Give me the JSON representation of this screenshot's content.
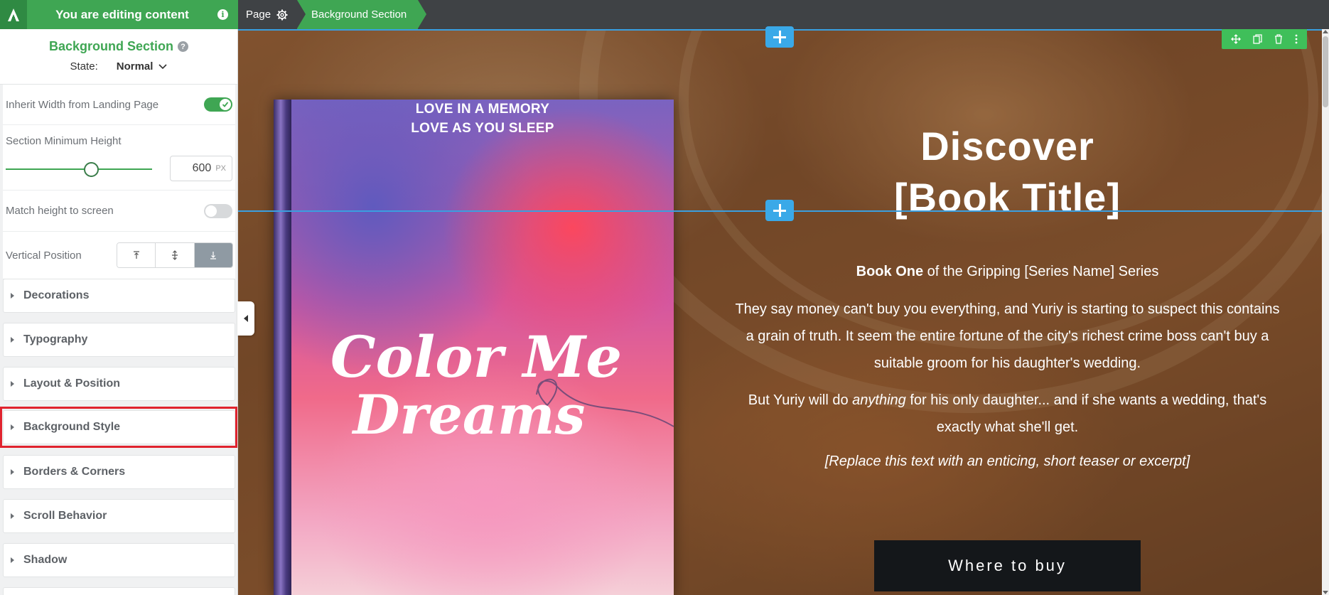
{
  "topbar": {
    "editing_label": "You are editing content",
    "crumbs": {
      "page": "Page",
      "active": "Background Section"
    }
  },
  "sidebar": {
    "title": "Background Section",
    "state_label": "State:",
    "state_value": "Normal",
    "inherit_width_label": "Inherit Width from Landing Page",
    "inherit_width_on": true,
    "min_height_label": "Section Minimum Height",
    "min_height_value": "600",
    "min_height_unit": "PX",
    "match_height_label": "Match height to screen",
    "match_height_on": false,
    "vertical_position_label": "Vertical Position",
    "vertical_position_active": "bottom",
    "accordions": [
      {
        "label": "Decorations"
      },
      {
        "label": "Typography"
      },
      {
        "label": "Layout & Position"
      },
      {
        "label": "Background Style"
      },
      {
        "label": "Borders & Corners"
      },
      {
        "label": "Scroll Behavior"
      },
      {
        "label": "Shadow"
      }
    ]
  },
  "canvas": {
    "book": {
      "tagline_1": "LOVE IN A MEMORY",
      "tagline_2": "LOVE AS YOU SLEEP",
      "title_1": "Color Me",
      "title_2": "Dreams"
    },
    "hero": {
      "heading_1": "Discover",
      "heading_2": "[Book Title]",
      "sub_bold": "Book One",
      "sub_rest": " of the Gripping [Series Name] Series",
      "para1": "They say money can't buy you everything, and Yuriy is starting to suspect this contains a grain of truth. It seem the entire fortune of the city's richest crime boss can't buy a suitable groom for his daughter's wedding.",
      "para2_a": "But Yuriy will do ",
      "para2_em": "anything",
      "para2_b": " for his only daughter... and if she wants a wedding, that's exactly what she'll get.",
      "para3": "[Replace this text with an enticing, short teaser or excerpt]",
      "button": "Where to buy"
    }
  },
  "colors": {
    "brand_green": "#3fa653",
    "guide_blue": "#3a9fe0",
    "highlight_red": "#e0232e"
  }
}
